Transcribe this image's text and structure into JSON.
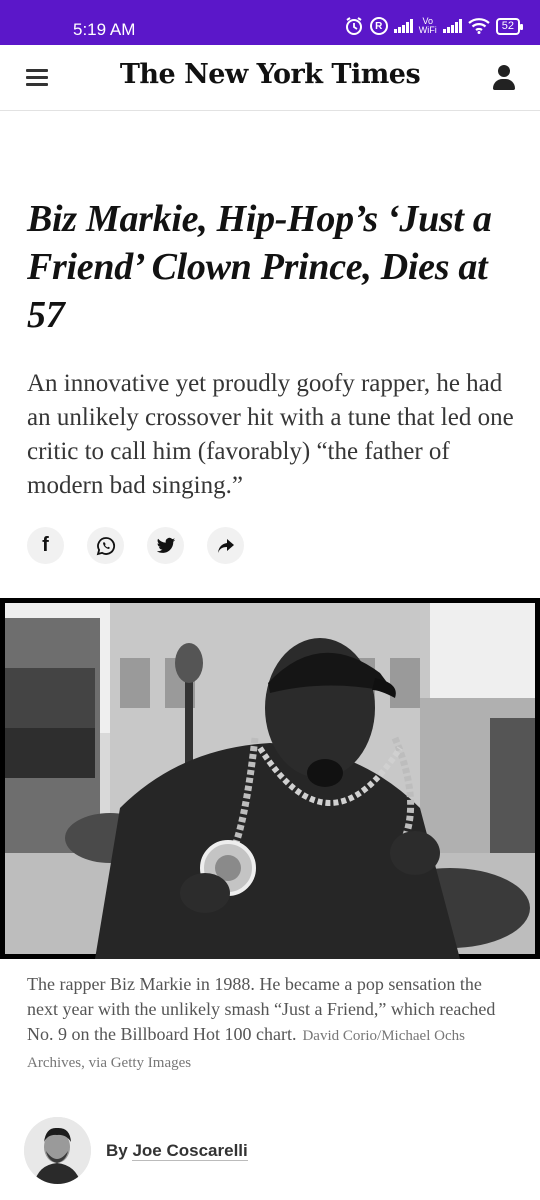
{
  "status_bar": {
    "time": "5:19 AM",
    "icons": [
      "alarm-icon",
      "registered-icon",
      "signal-icon",
      "vowifi-icon",
      "signal-icon",
      "wifi-icon",
      "battery-icon"
    ],
    "vowifi_top": "Vo",
    "vowifi_bottom": "WiFi",
    "battery_level": "52",
    "registered_glyph": "R",
    "background": "#5b17c9"
  },
  "header": {
    "masthead": "The New York Times",
    "menu_icon": "hamburger-menu-icon",
    "account_icon": "user-account-icon"
  },
  "article": {
    "headline": "Biz Markie, Hip-Hop’s ‘Just a Friend’ Clown Prince, Dies at 57",
    "summary": "An innovative yet proudly goofy rapper, he had an unlikely crossover hit with a tune that led one critic to call him (favorably) “the father of modern bad singing.”",
    "share": {
      "facebook_glyph": "f",
      "buttons": [
        "facebook-share-icon",
        "whatsapp-share-icon",
        "twitter-share-icon",
        "forward-share-icon"
      ]
    },
    "image": {
      "caption": "The rapper Biz Markie in 1988. He became a pop sensation the next year with the unlikely smash “Just a Friend,” which reached No. 9 on the Billboard Hot 100 chart.",
      "credit": "David Corio/Michael Ochs Archives, via Getty Images"
    },
    "byline": {
      "prefix": "By",
      "author": "Joe Coscarelli"
    }
  }
}
